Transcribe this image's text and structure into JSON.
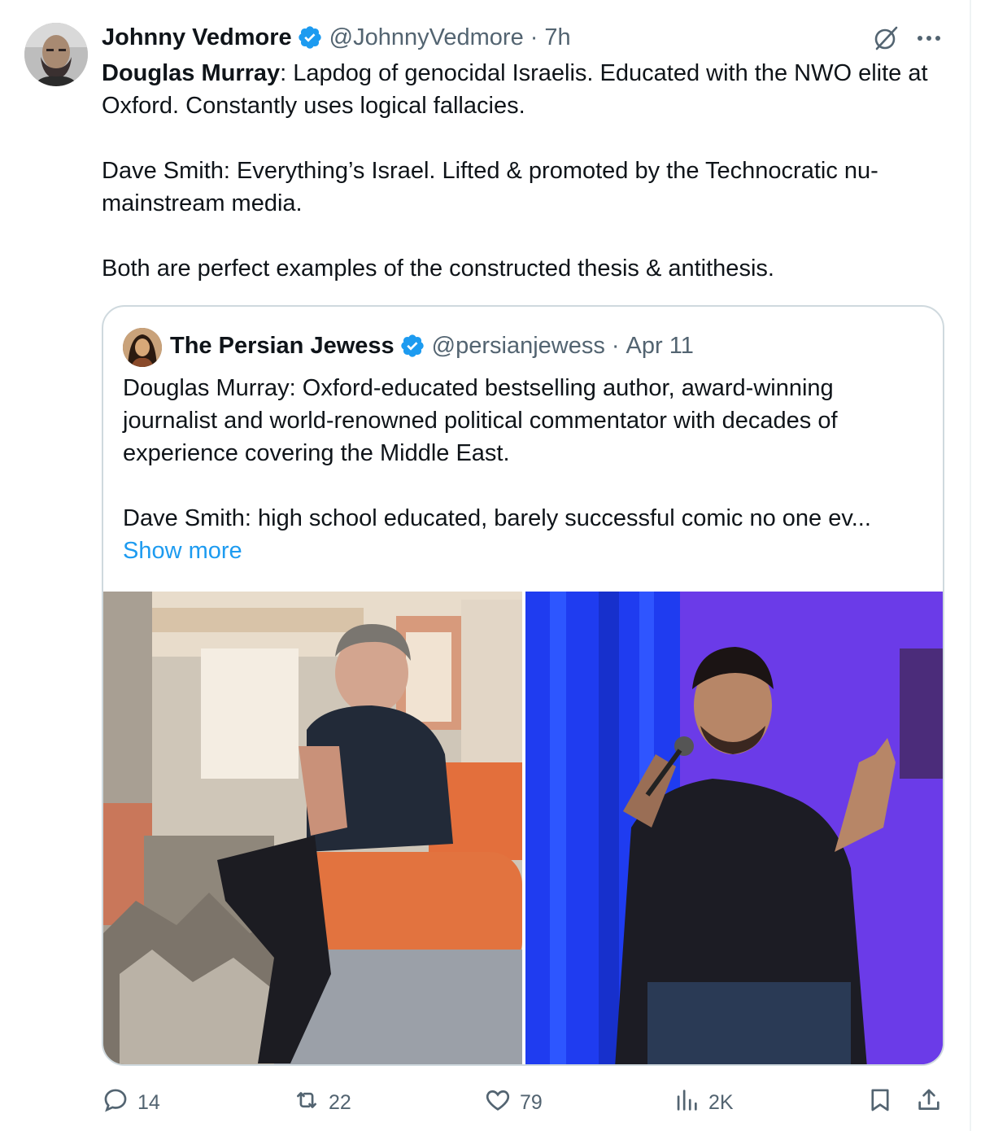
{
  "tweet": {
    "author_name": "Johnny Vedmore",
    "handle": "@JohnnyVedmore",
    "separator": "·",
    "time": "7h",
    "text": {
      "p1_bold": "Douglas Murray",
      "p1_rest": ": Lapdog of genocidal Israelis. Educated with the NWO elite at Oxford. Constantly uses logical fallacies.",
      "p2": "Dave Smith: Everything’s Israel. Lifted & promoted by the Technocratic nu-mainstream media.",
      "p3": "Both are perfect examples of the constructed thesis & antithesis."
    }
  },
  "quoted": {
    "author_name": "The Persian Jewess",
    "handle": "@persianjewess",
    "separator": "·",
    "time": "Apr 11",
    "p1": "Douglas Murray: Oxford-educated bestselling author, award-winning journalist and world-renowned political commentator with decades of experience covering the Middle East.",
    "p2": "Dave Smith: high school educated, barely successful comic no one ev...",
    "show_more": "Show more"
  },
  "metrics": {
    "replies": "14",
    "reposts": "22",
    "likes": "79",
    "views": "2K"
  },
  "colors": {
    "text": "#0f1419",
    "secondary": "#536471",
    "link": "#1d9bf0",
    "verified": "#1d9bf0",
    "border": "#cfd9de"
  },
  "icons": [
    "verified-badge-icon",
    "grok-icon",
    "more-icon",
    "reply-icon",
    "repost-icon",
    "like-icon",
    "views-icon",
    "bookmark-icon",
    "share-icon"
  ]
}
